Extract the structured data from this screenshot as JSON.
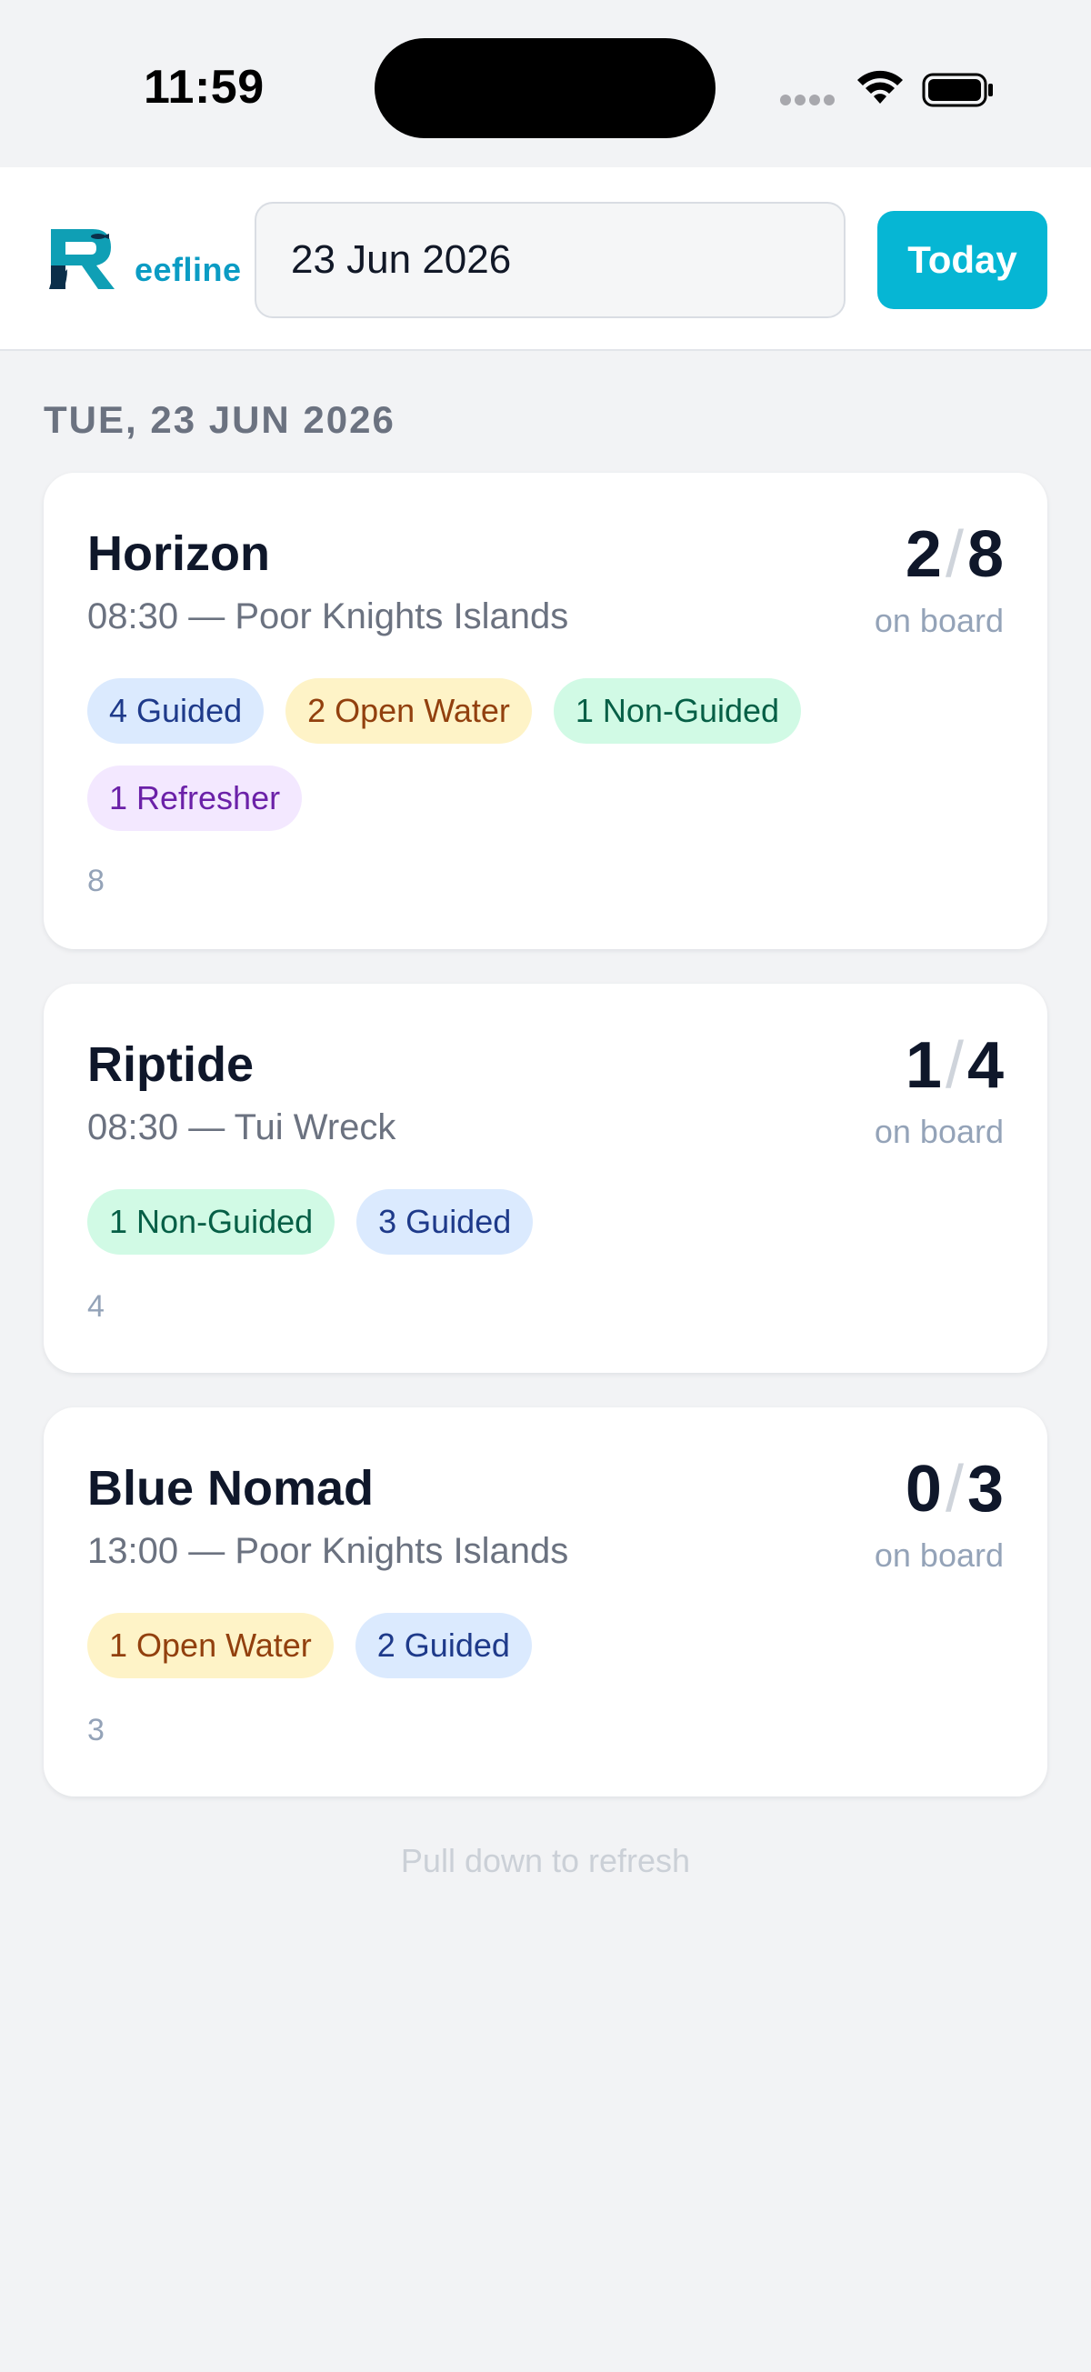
{
  "status_bar": {
    "time": "11:59"
  },
  "header": {
    "logo_text": "eefline",
    "logo_initial": "R",
    "date_value": "23 Jun 2026",
    "today_label": "Today"
  },
  "section": {
    "date_heading": "TUE, 23 JUN 2026"
  },
  "trips": [
    {
      "boat": "Horizon",
      "subtitle": "08:30 — Poor Knights Islands",
      "on_board": "2",
      "capacity": "8",
      "on_board_label": "on board",
      "tags": [
        {
          "label": "4 Guided",
          "kind": "guided"
        },
        {
          "label": "2 Open Water",
          "kind": "open"
        },
        {
          "label": "1 Non-Guided",
          "kind": "nonguided"
        },
        {
          "label": "1 Refresher",
          "kind": "refresher"
        }
      ],
      "footer": "8"
    },
    {
      "boat": "Riptide",
      "subtitle": "08:30 — Tui Wreck",
      "on_board": "1",
      "capacity": "4",
      "on_board_label": "on board",
      "tags": [
        {
          "label": "1 Non-Guided",
          "kind": "nonguided"
        },
        {
          "label": "3 Guided",
          "kind": "guided"
        }
      ],
      "footer": "4"
    },
    {
      "boat": "Blue Nomad",
      "subtitle": "13:00 — Poor Knights Islands",
      "on_board": "0",
      "capacity": "3",
      "on_board_label": "on board",
      "tags": [
        {
          "label": "1 Open Water",
          "kind": "open"
        },
        {
          "label": "2 Guided",
          "kind": "guided"
        }
      ],
      "footer": "3"
    }
  ],
  "refresh_hint": "Pull down to refresh",
  "colors": {
    "accent": "#06b6d4",
    "guided_bg": "#dbeafe",
    "open_water_bg": "#fef3c7",
    "non_guided_bg": "#d1fae5",
    "refresher_bg": "#f3e8ff"
  }
}
